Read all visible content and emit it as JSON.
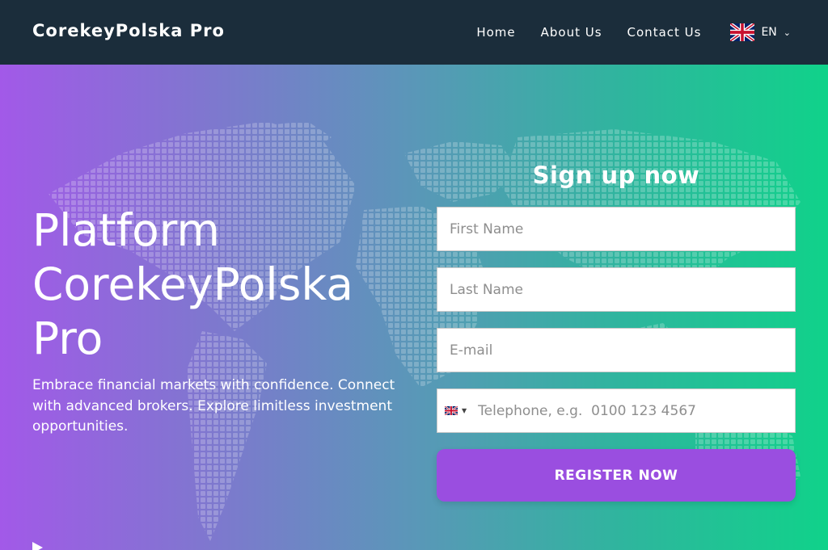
{
  "header": {
    "brand": "CorekeyPolska Pro",
    "nav": [
      {
        "label": "Home"
      },
      {
        "label": "About Us"
      },
      {
        "label": "Contact Us"
      }
    ],
    "language": {
      "code": "EN",
      "flag_icon": "uk-flag-icon",
      "chevron_icon": "chevron-down-icon"
    }
  },
  "hero": {
    "title": "Platform CorekeyPolska Pro",
    "subtitle": "Embrace financial markets with confidence. Connect with advanced brokers. Explore limitless investment opportunities."
  },
  "form": {
    "title": "Sign up now",
    "first_name": {
      "placeholder": "First Name",
      "value": ""
    },
    "last_name": {
      "placeholder": "Last Name",
      "value": ""
    },
    "email": {
      "placeholder": "E-mail",
      "value": ""
    },
    "phone": {
      "placeholder": "Telephone, e.g.  0100 123 4567",
      "value": "",
      "country_flag_icon": "uk-flag-icon"
    },
    "submit_label": "REGISTER NOW"
  },
  "colors": {
    "header_bg": "#1b2d3b",
    "gradient_start": "#a259e8",
    "gradient_end": "#10d28a",
    "button_bg": "#9a4ee0"
  }
}
